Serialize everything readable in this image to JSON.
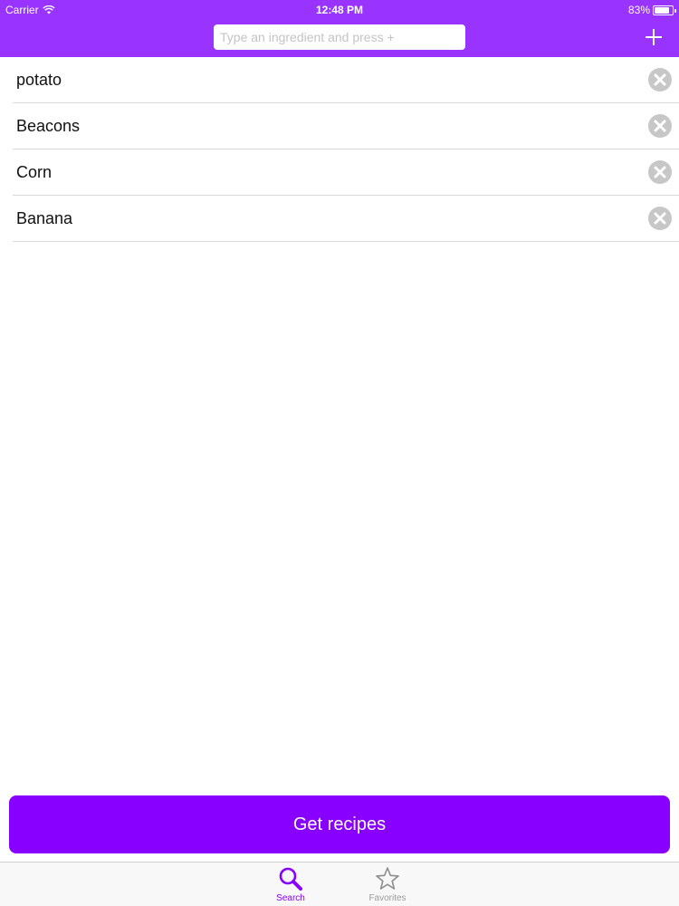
{
  "status_bar": {
    "carrier": "Carrier",
    "time": "12:48 PM",
    "battery": "83%",
    "battery_level": 0.83
  },
  "search": {
    "placeholder": "Type an ingredient and press +",
    "value": ""
  },
  "header": {
    "add_icon": "plus-icon"
  },
  "ingredients": [
    {
      "name": "potato"
    },
    {
      "name": "Beacons"
    },
    {
      "name": "Corn"
    },
    {
      "name": "Banana"
    }
  ],
  "delete_icon": "close-circle-icon",
  "cta": {
    "label": "Get recipes"
  },
  "tabs": [
    {
      "label": "Search",
      "icon": "search-icon",
      "selected": true
    },
    {
      "label": "Favorites",
      "icon": "star-icon",
      "selected": false
    }
  ],
  "colors": {
    "header_bg": "#9933ff",
    "accent": "#8800ff",
    "delete_icon": "#c7c7c7"
  }
}
